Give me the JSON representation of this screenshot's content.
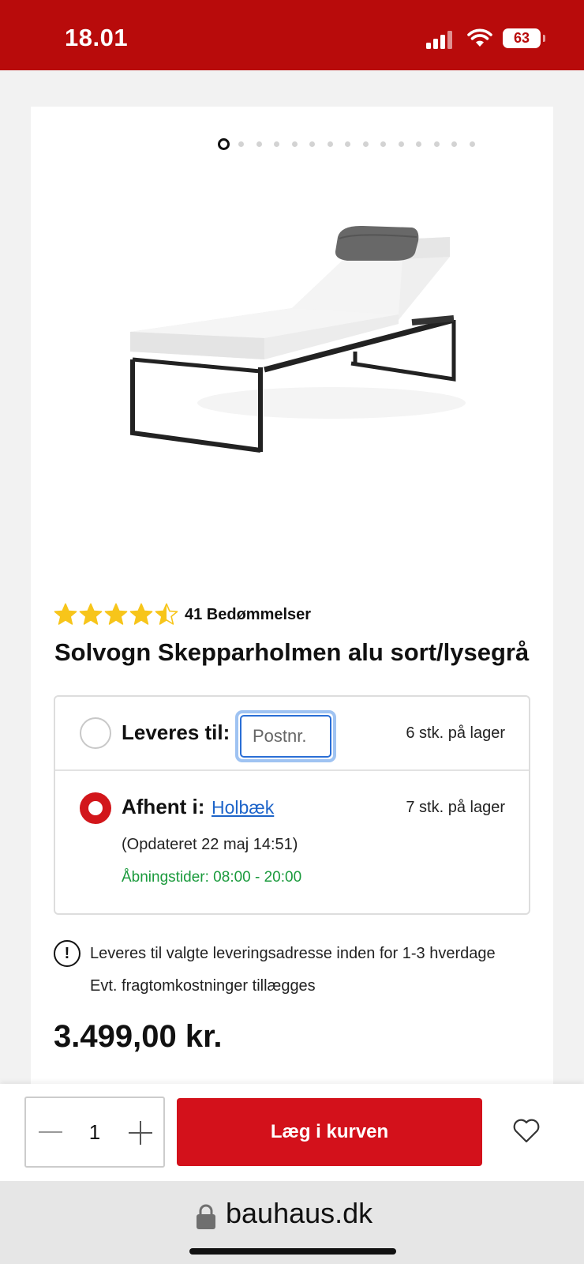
{
  "status_bar": {
    "time": "18.01",
    "battery": "63"
  },
  "gallery": {
    "dot_count": 15,
    "active_index": 0
  },
  "product": {
    "rating_value": 4.5,
    "rating_max": 5,
    "rating_count_label": "41 Bedømmelser",
    "title": "Solvogn Skepparholmen alu sort/lysegrå"
  },
  "delivery": {
    "ship_label": "Leveres til:",
    "postal_placeholder": "Postnr.",
    "ship_stock": "6 stk. på lager",
    "pickup_label": "Afhent i:",
    "pickup_store": "Holbæk",
    "pickup_stock": "7 stk. på lager",
    "updated": "(Opdateret 22 maj 14:51)",
    "hours": "Åbningstider: 08:00 - 20:00"
  },
  "info": {
    "icon_text": "!",
    "line1": "Leveres til valgte leveringsadresse inden for 1-3 hverdage",
    "line2": "Evt. fragtomkostninger tillægges"
  },
  "price": "3.499,00 kr.",
  "cart": {
    "quantity": "1",
    "button_label": "Læg i kurven"
  },
  "browser": {
    "domain": "bauhaus.dk"
  },
  "colors": {
    "brand_red": "#b80b0b",
    "button_red": "#d3111b",
    "star": "#f7c51a",
    "link": "#1d64c9",
    "hours_green": "#1a9a3c"
  }
}
